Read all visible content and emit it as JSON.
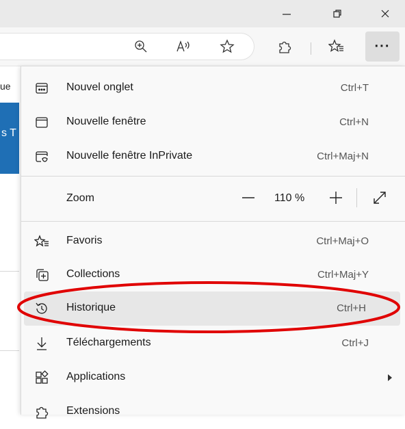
{
  "page_behind": {
    "text_fragment": "ue",
    "blue_text": "s T"
  },
  "menu": {
    "items_top": [
      {
        "label": "Nouvel onglet",
        "shortcut": "Ctrl+T",
        "icon": "new-tab-icon"
      },
      {
        "label": "Nouvelle fenêtre",
        "shortcut": "Ctrl+N",
        "icon": "new-window-icon"
      },
      {
        "label": "Nouvelle fenêtre InPrivate",
        "shortcut": "Ctrl+Maj+N",
        "icon": "inprivate-icon"
      }
    ],
    "zoom": {
      "label": "Zoom",
      "value": "110 %",
      "minus": "—",
      "plus": "+"
    },
    "items_bottom": [
      {
        "label": "Favoris",
        "shortcut": "Ctrl+Maj+O",
        "icon": "favorites-icon"
      },
      {
        "label": "Collections",
        "shortcut": "Ctrl+Maj+Y",
        "icon": "collections-icon"
      },
      {
        "label": "Historique",
        "shortcut": "Ctrl+H",
        "icon": "history-icon"
      },
      {
        "label": "Téléchargements",
        "shortcut": "Ctrl+J",
        "icon": "download-icon"
      },
      {
        "label": "Applications",
        "shortcut": "",
        "icon": "apps-icon"
      },
      {
        "label": "Extensions",
        "shortcut": "",
        "icon": "extensions-icon"
      }
    ]
  },
  "toolbar": {
    "more_label": "···"
  },
  "colors": {
    "annotation": "#e00000",
    "menu_bg": "#f9f9f9",
    "highlight_bg": "#e7e7e7",
    "page_accent": "#1f6fb5"
  }
}
